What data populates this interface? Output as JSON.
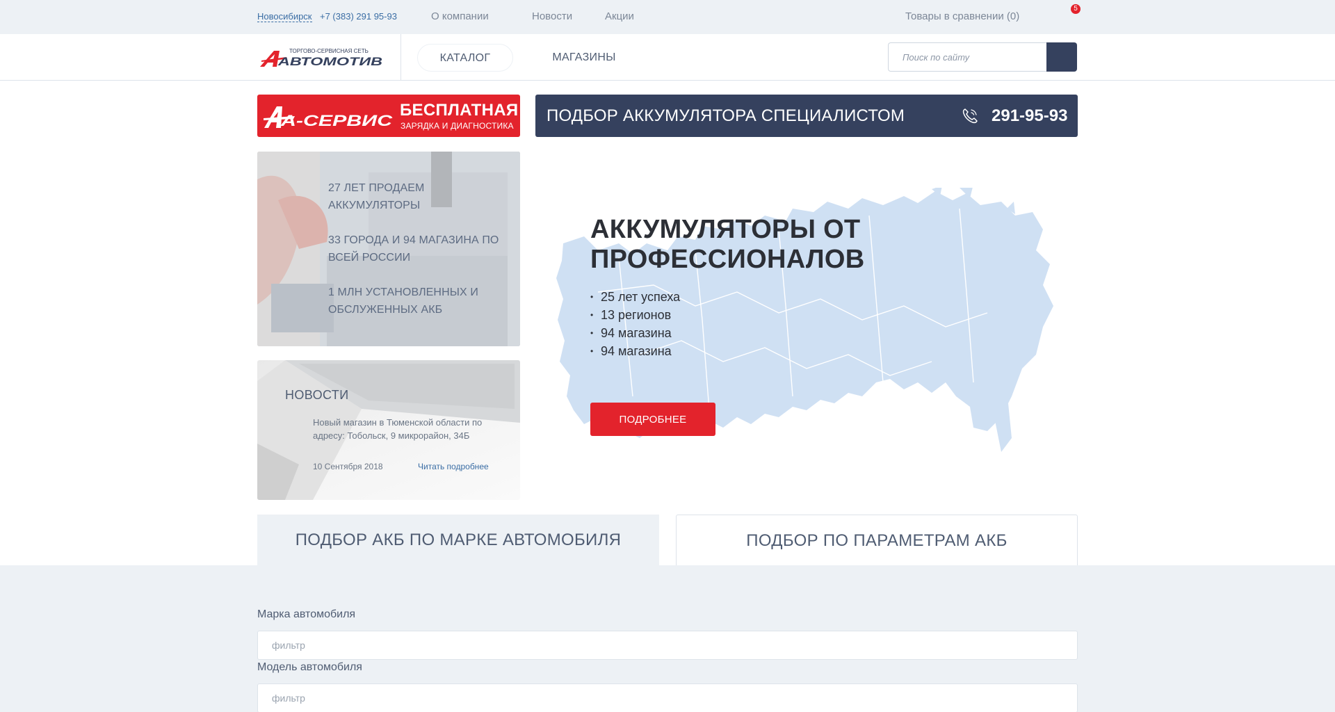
{
  "topbar": {
    "city": "Новосибирск",
    "phone": "+7 (383) 291 95-93",
    "links": [
      "О компании",
      "Новости",
      "Акции"
    ],
    "compare": "Товары в сравнении (0)",
    "cart_count": "5"
  },
  "header": {
    "logo_tagline": "ТОРГОВО-СЕРВИСНАЯ СЕТЬ",
    "logo_name": "АВТОМОТИВ",
    "nav": [
      "КАТАЛОГ",
      "МАГАЗИНЫ"
    ],
    "search_placeholder": "Поиск по сайту"
  },
  "aservice": {
    "logo_text": "А-СЕРВИС",
    "free": "БЕСПЛАТНАЯ",
    "subtitle": "ЗАРЯДКА И ДИАГНОСТИКА"
  },
  "specialist": {
    "title": "ПОДБОР АККУМУЛЯТОРА СПЕЦИАЛИСТОМ",
    "phone": "291-95-93"
  },
  "facts": [
    "27 ЛЕТ ПРОДАЕМ АККУМУЛЯТОРЫ",
    "33 ГОРОДА И 94 МАГАЗИНА ПО ВСЕЙ РОССИИ",
    "1 МЛН УСТАНОВЛЕННЫХ И ОБСЛУЖЕННЫХ АКБ"
  ],
  "news": {
    "title": "НОВОСТИ",
    "text": "Новый магазин в Тюменской области по адресу: Тобольск, 9 микрорайон, 34Б",
    "date": "10 Сентября 2018",
    "more": "Читать подробнее"
  },
  "hero": {
    "title": "АККУМУЛЯТОРЫ ОТ ПРОФЕССИОНАЛОВ",
    "bullets": [
      "25 лет успеха",
      "13 регионов",
      "94 магазина",
      "94 магазина"
    ],
    "button": "ПОДРОБНЕЕ"
  },
  "tabs": {
    "by_car": "ПОДБОР АКБ ПО МАРКЕ АВТОМОБИЛЯ",
    "by_params": "ПОДБОР ПО ПАРАМЕТРАМ АКБ"
  },
  "form": {
    "brand_label": "Марка автомобиля",
    "brand_placeholder": "фильтр",
    "model_label": "Модель автомобиля",
    "model_placeholder": "фильтр"
  },
  "colors": {
    "brand_red": "#e3232c",
    "brand_navy": "#35415e",
    "bg_light": "#edf1f5",
    "map_blue": "#cfe0f3"
  }
}
